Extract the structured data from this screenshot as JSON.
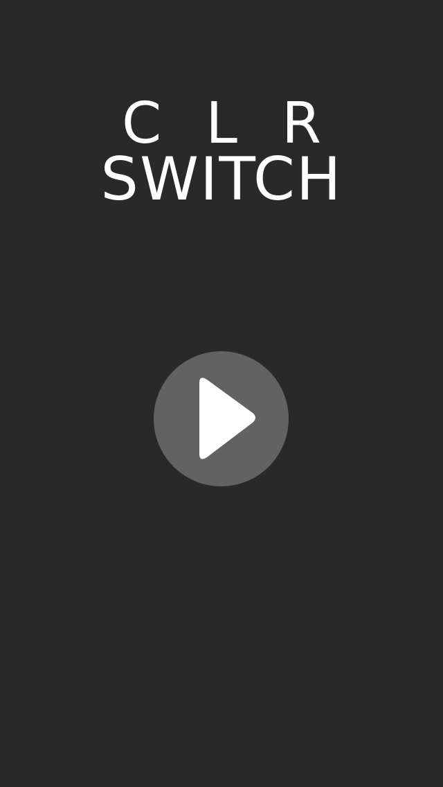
{
  "title": {
    "line1": "CLR",
    "line2": "SWITCH"
  },
  "play_button": {
    "icon": "play-icon",
    "background_color": "#626262",
    "icon_color": "#ffffff"
  },
  "colors": {
    "background": "#292929",
    "text": "#ffffff"
  }
}
